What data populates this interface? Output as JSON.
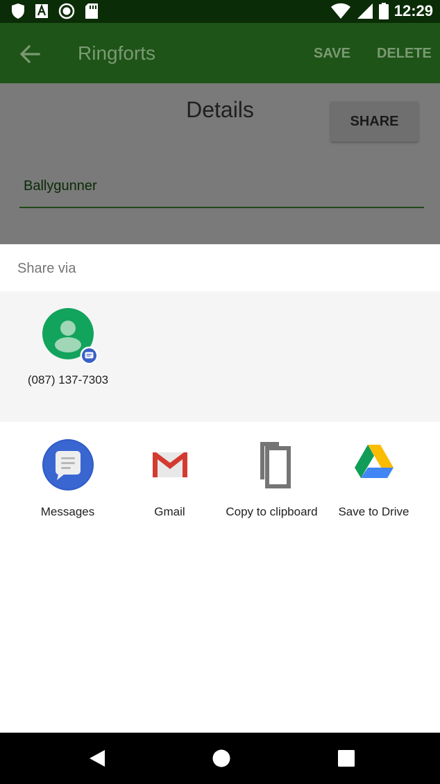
{
  "status_bar": {
    "time": "12:29",
    "left_icons": [
      "shield-icon",
      "font-a-icon",
      "record-icon",
      "sd-card-icon"
    ],
    "right_icons": [
      "wifi-icon",
      "signal-icon",
      "battery-icon"
    ]
  },
  "app_bar": {
    "title": "Ringforts",
    "save_label": "SAVE",
    "delete_label": "DELETE",
    "back_icon": "arrow-back-icon",
    "color": "#1e5417"
  },
  "details": {
    "title": "Details",
    "share_label": "SHARE",
    "name_value": "Ballygunner"
  },
  "share_sheet": {
    "title": "Share via",
    "direct_targets": [
      {
        "label": "(087) 137-7303",
        "icon": "contact-avatar-icon",
        "badge": "messages-badge-icon"
      }
    ],
    "apps": [
      {
        "label": "Messages",
        "icon": "messages-icon"
      },
      {
        "label": "Gmail",
        "icon": "gmail-icon"
      },
      {
        "label": "Copy to clipboard",
        "icon": "copy-icon"
      },
      {
        "label": "Save to Drive",
        "icon": "google-drive-icon"
      }
    ]
  },
  "nav_bar": {
    "icons": [
      "back-triangle-icon",
      "home-circle-icon",
      "recents-square-icon"
    ]
  }
}
